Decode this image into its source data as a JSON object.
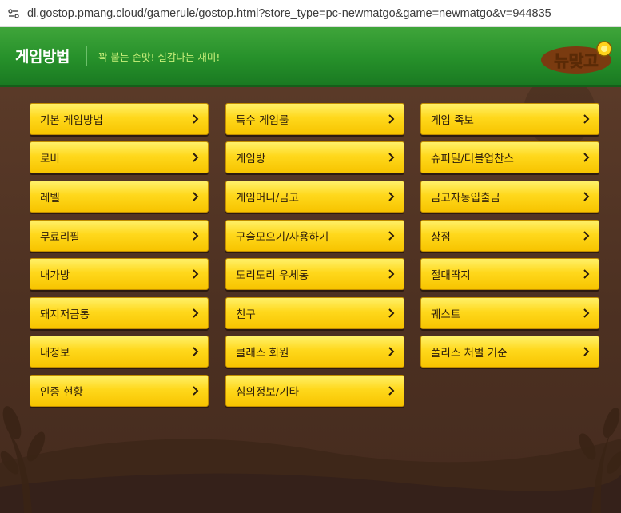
{
  "browser": {
    "url": "dl.gostop.pmang.cloud/gamerule/gostop.html?store_type=pc-newmatgo&game=newmatgo&v=944835"
  },
  "header": {
    "title": "게임방법",
    "tagline": "꽉 붙는 손맛! 실감나는 재미!",
    "logo_text": "뉴맞고"
  },
  "menu": {
    "col1": [
      {
        "label": "기본 게임방법"
      },
      {
        "label": "로비"
      },
      {
        "label": "레벨"
      },
      {
        "label": "무료리필"
      },
      {
        "label": "내가방"
      },
      {
        "label": "돼지저금통"
      },
      {
        "label": "내정보"
      },
      {
        "label": "인증 현황"
      }
    ],
    "col2": [
      {
        "label": "특수 게임룰"
      },
      {
        "label": "게임방"
      },
      {
        "label": "게임머니/금고"
      },
      {
        "label": "구슬모으기/사용하기"
      },
      {
        "label": "도리도리 우체통"
      },
      {
        "label": "친구"
      },
      {
        "label": "클래스 회원"
      },
      {
        "label": "심의정보/기타"
      }
    ],
    "col3": [
      {
        "label": "게임 족보"
      },
      {
        "label": "슈퍼딜/더블업찬스"
      },
      {
        "label": "금고자동입출금"
      },
      {
        "label": "상점"
      },
      {
        "label": "절대딱지"
      },
      {
        "label": "퀘스트"
      },
      {
        "label": "폴리스 처벌 기준"
      }
    ]
  },
  "colors": {
    "header_green": "#26902a",
    "button_yellow": "#ffd81c",
    "background_brown": "#4d3122",
    "tagline_green": "#c9f07a"
  }
}
